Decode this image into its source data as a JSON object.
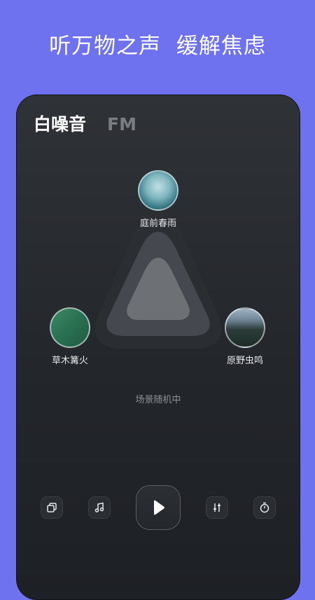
{
  "headline": "听万物之声  缓解焦虑",
  "tabs": [
    {
      "label": "白噪音",
      "active": true
    },
    {
      "label": "FM",
      "active": false
    }
  ],
  "scenes": [
    {
      "label": "庭前春雨",
      "icon": "rain-scene-thumbnail"
    },
    {
      "label": "草木篝火",
      "icon": "leaf-scene-thumbnail"
    },
    {
      "label": "原野虫鸣",
      "icon": "forest-scene-thumbnail"
    }
  ],
  "status": "场景随机中",
  "controls": {
    "icons": [
      "layers-icon",
      "music-note-icon",
      "play-icon",
      "equalizer-icon",
      "timer-icon"
    ]
  },
  "colors": {
    "background": "#6f72ee",
    "panel": "#2a2d32",
    "text_primary": "#ffffff",
    "text_muted": "#8e9095"
  }
}
